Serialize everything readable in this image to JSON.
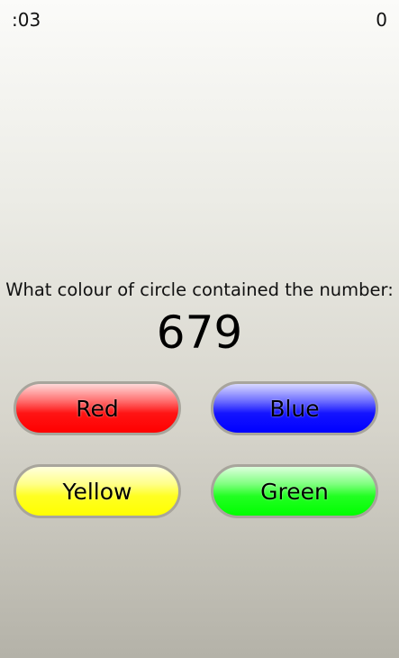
{
  "header": {
    "timer": ":03",
    "score": "0"
  },
  "question": {
    "text": "What colour of circle contained the number:",
    "number": "679"
  },
  "answers": {
    "red": "Red",
    "blue": "Blue",
    "yellow": "Yellow",
    "green": "Green"
  },
  "colors": {
    "red": "#ff0000",
    "blue": "#0000ff",
    "yellow": "#ffff00",
    "green": "#00ff00",
    "button_border": "#a8a59c"
  }
}
